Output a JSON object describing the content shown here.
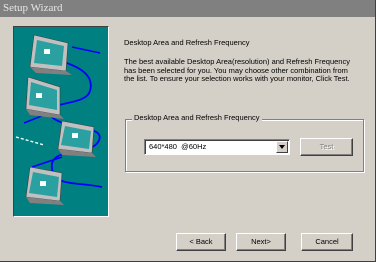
{
  "window": {
    "title": "Setup Wizard"
  },
  "content": {
    "heading": "Desktop Area and Refresh Frequency",
    "description": "The best available Desktop Area(resolution) and Refresh Frequency has been selected for you. You may choose other combination from the list. To ensure your selection works with your monitor, Click Test."
  },
  "group": {
    "label": "Desktop Area and Refresh Frequency",
    "selected_mode": "640*480  @60Hz",
    "test_label": "Test"
  },
  "buttons": {
    "back_label": "< Back",
    "next_label": "Next>",
    "cancel_label": "Cancel"
  },
  "colors": {
    "dialog_bg": "#d4d0c8",
    "art_bg": "#008080",
    "cable": "#0000ff"
  }
}
